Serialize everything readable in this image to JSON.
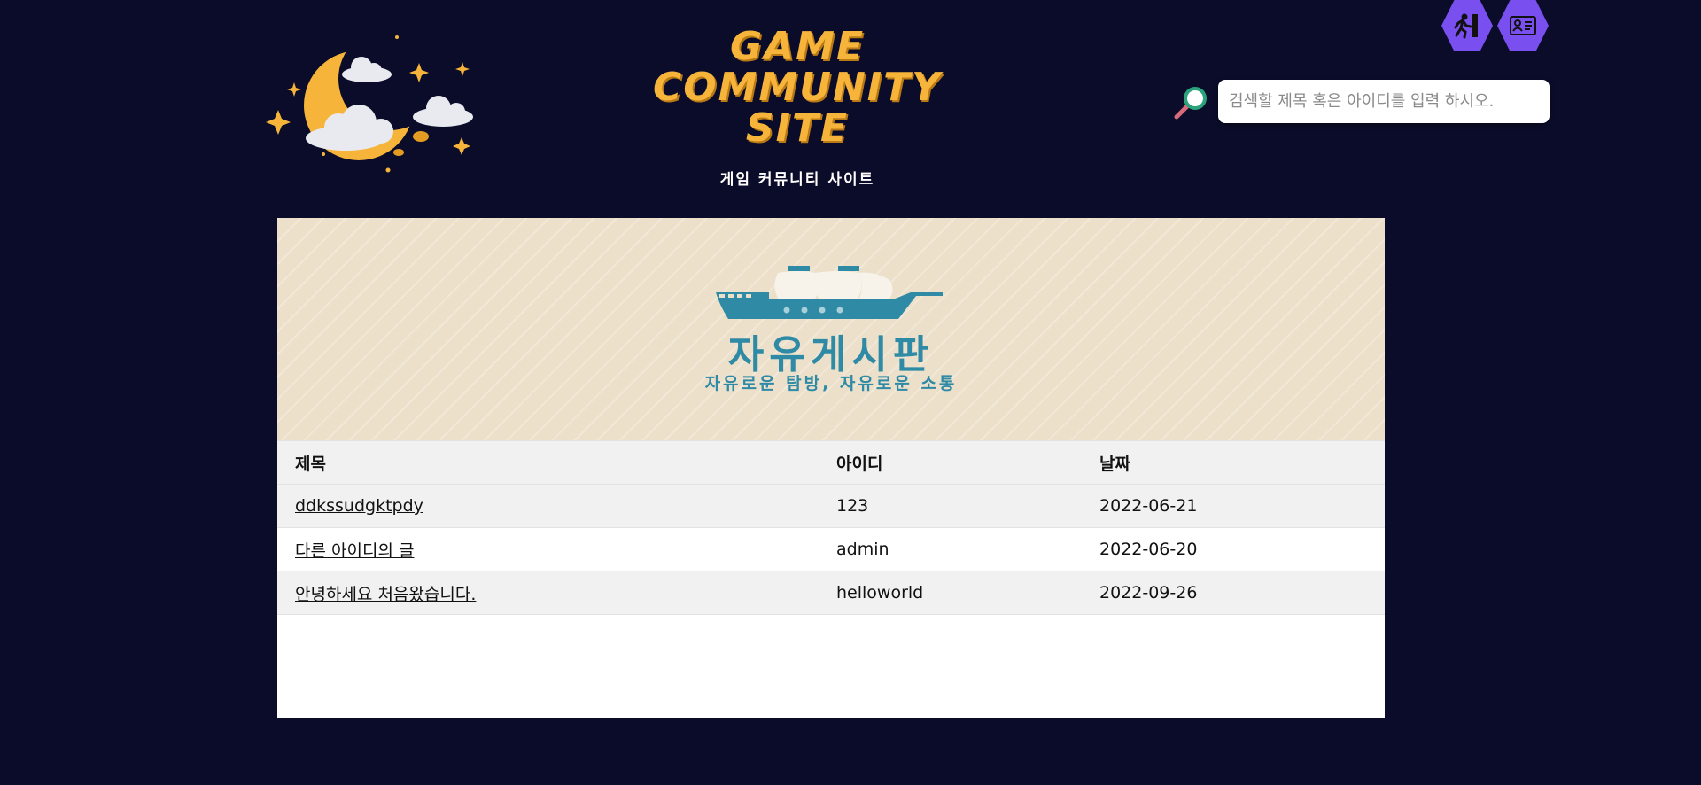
{
  "header": {
    "site_title": "GAME COMMUNITY SITE",
    "site_subtitle": "게임 커뮤니티 사이트",
    "logout_icon": "logout-icon",
    "profile_icon": "profile-card-icon",
    "search": {
      "icon": "search-icon",
      "placeholder": "검색할 제목 혹은 아이디를 입력 하시오."
    }
  },
  "banner": {
    "title": "자유게시판",
    "subtitle": "자유로운 탐방, 자유로운 소통",
    "icon": "ship-icon"
  },
  "table": {
    "headers": {
      "title": "제목",
      "id": "아이디",
      "date": "날짜"
    },
    "rows": [
      {
        "title": "ddkssudgktpdy",
        "id": "123",
        "date": "2022-06-21"
      },
      {
        "title": "다른 아이디의 글",
        "id": "admin",
        "date": "2022-06-20"
      },
      {
        "title": "안녕하세요 처음왔습니다.",
        "id": "helloworld",
        "date": "2022-09-26"
      }
    ]
  },
  "colors": {
    "background": "#0b0c2a",
    "accent_purple": "#7a4ff0",
    "title_orange": "#f6b43a",
    "banner_teal": "#2f8aa6",
    "banner_bg": "#ece0cb"
  }
}
